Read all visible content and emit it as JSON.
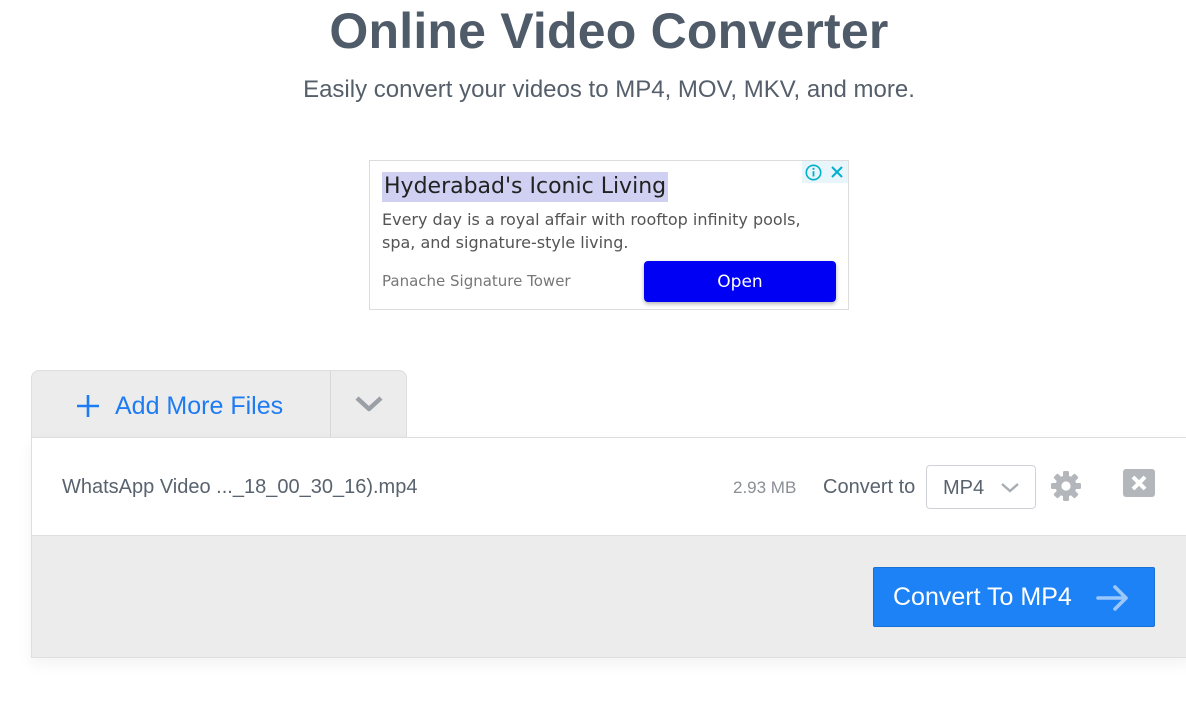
{
  "header": {
    "title": "Online Video Converter",
    "subtitle": "Easily convert your videos to MP4, MOV, MKV, and more."
  },
  "ad": {
    "headline": "Hyderabad's Iconic Living",
    "body": "Every day is a royal affair with rooftop infinity pools, spa, and signature-style living.",
    "advertiser": "Panache Signature Tower",
    "cta_label": "Open",
    "icons": [
      "info-icon",
      "close-icon"
    ],
    "colors": {
      "cta_bg": "#0000f5",
      "headline_highlight": "#cfd0f2"
    }
  },
  "toolbar": {
    "add_files_label": "Add More Files",
    "icons": [
      "plus-icon",
      "chevron-down-icon"
    ]
  },
  "files": [
    {
      "name": "WhatsApp Video ..._18_00_30_16).mp4",
      "size": "2.93 MB",
      "convert_to_label": "Convert to",
      "format": "MP4",
      "icons": [
        "settings-gear-icon",
        "remove-file-icon"
      ]
    }
  ],
  "actions": {
    "convert_label": "Convert To MP4",
    "icon": "arrow-right-icon"
  },
  "colors": {
    "accent": "#1d82f5",
    "title_text": "#4f5b69",
    "panel_bg": "#ececec"
  }
}
